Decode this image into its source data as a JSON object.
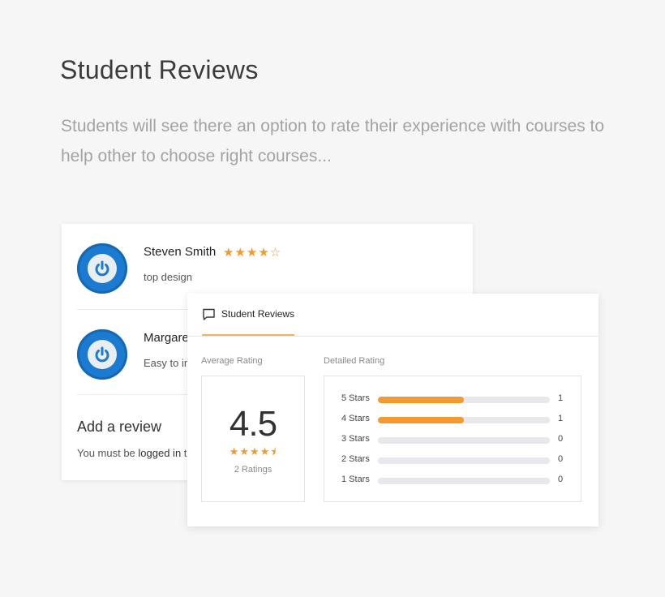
{
  "header": {
    "title": "Student Reviews",
    "description": "Students will see there an option to rate their experience with courses to help other to choose right courses..."
  },
  "reviews_card": {
    "reviews": [
      {
        "name": "Steven Smith",
        "stars": "★★★★☆",
        "rating": 4,
        "text": "top design"
      },
      {
        "name": "Margare",
        "text": "Easy to in"
      }
    ],
    "add_review_title": "Add a review",
    "login_prefix": "You must be ",
    "login_link": "logged in",
    "login_suffix": " t"
  },
  "ratings_card": {
    "tab_label": "Student Reviews",
    "average_label": "Average Rating",
    "detailed_label": "Detailed Rating",
    "average_value": "4.5",
    "average_stars": "★★★★⯨",
    "ratings_count": "2 Ratings",
    "rows": [
      {
        "label": "5 Stars",
        "count": "1",
        "fraction": 0.5
      },
      {
        "label": "4 Stars",
        "count": "1",
        "fraction": 0.5
      },
      {
        "label": "3 Stars",
        "count": "0",
        "fraction": 0
      },
      {
        "label": "2 Stars",
        "count": "0",
        "fraction": 0
      },
      {
        "label": "1 Stars",
        "count": "0",
        "fraction": 0
      }
    ]
  },
  "colors": {
    "accent": "#f29a2e",
    "avatar_blue": "#1b7bd0",
    "tab_underline": "#f6b25a"
  }
}
